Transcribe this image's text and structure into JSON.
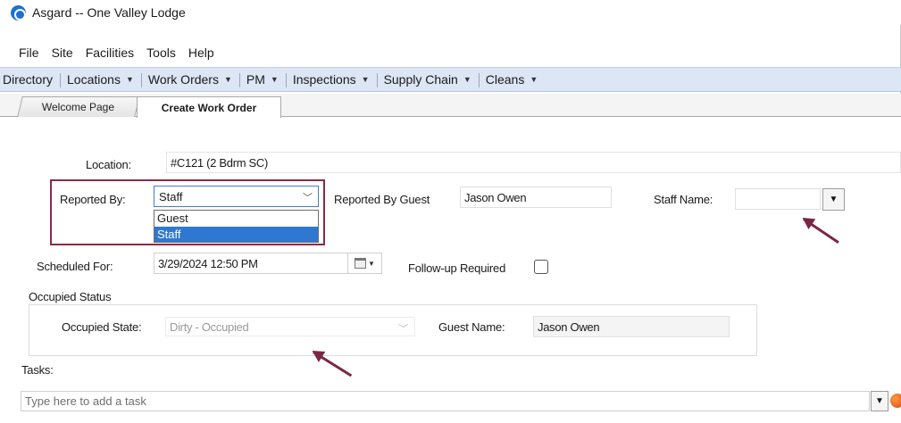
{
  "window": {
    "title": "Asgard -- One Valley Lodge"
  },
  "menubar": {
    "items": [
      "File",
      "Site",
      "Facilities",
      "Tools",
      "Help"
    ]
  },
  "navbar": {
    "items": [
      {
        "label": "Directory",
        "dropdown": false
      },
      {
        "label": "Locations",
        "dropdown": true
      },
      {
        "label": "Work Orders",
        "dropdown": true
      },
      {
        "label": "PM",
        "dropdown": true
      },
      {
        "label": "Inspections",
        "dropdown": true
      },
      {
        "label": "Supply Chain",
        "dropdown": true
      },
      {
        "label": "Cleans",
        "dropdown": true
      }
    ]
  },
  "tabs": [
    {
      "label": "Welcome Page",
      "active": false
    },
    {
      "label": "Create Work Order",
      "active": true
    }
  ],
  "form": {
    "location": {
      "label": "Location:",
      "value": "#C121 (2 Bdrm SC)"
    },
    "reported_by": {
      "label": "Reported By:",
      "value": "Staff",
      "options": [
        "Guest",
        "Staff"
      ],
      "highlighted_option": "Staff"
    },
    "reported_by_guest": {
      "label": "Reported By Guest",
      "value": "Jason Owen"
    },
    "staff_name": {
      "label": "Staff Name:",
      "value": ""
    },
    "scheduled_for": {
      "label": "Scheduled For:",
      "value": "3/29/2024 12:50 PM"
    },
    "followup": {
      "label": "Follow-up Required",
      "checked": false
    },
    "occupied_status": {
      "group_label": "Occupied Status",
      "state_label": "Occupied State:",
      "state_value": "Dirty - Occupied",
      "state_disabled": true,
      "guest_name_label": "Guest Name:",
      "guest_name_value": "Jason Owen"
    },
    "tasks": {
      "label": "Tasks:",
      "placeholder": "Type here to add a task"
    }
  },
  "colors": {
    "nav_bg": "#dce6f4",
    "highlight_box": "#8b2a45",
    "annotation_arrow": "#7a2742",
    "selected_option": "#2f78d1"
  }
}
